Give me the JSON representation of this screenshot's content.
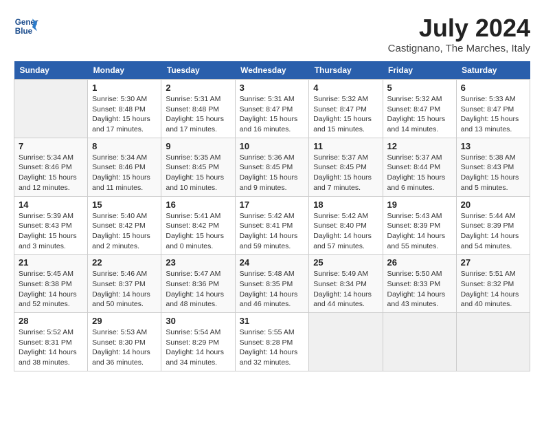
{
  "header": {
    "logo_line1": "General",
    "logo_line2": "Blue",
    "month_title": "July 2024",
    "location": "Castignano, The Marches, Italy"
  },
  "columns": [
    "Sunday",
    "Monday",
    "Tuesday",
    "Wednesday",
    "Thursday",
    "Friday",
    "Saturday"
  ],
  "weeks": [
    [
      {
        "day": "",
        "info": ""
      },
      {
        "day": "1",
        "info": "Sunrise: 5:30 AM\nSunset: 8:48 PM\nDaylight: 15 hours\nand 17 minutes."
      },
      {
        "day": "2",
        "info": "Sunrise: 5:31 AM\nSunset: 8:48 PM\nDaylight: 15 hours\nand 17 minutes."
      },
      {
        "day": "3",
        "info": "Sunrise: 5:31 AM\nSunset: 8:47 PM\nDaylight: 15 hours\nand 16 minutes."
      },
      {
        "day": "4",
        "info": "Sunrise: 5:32 AM\nSunset: 8:47 PM\nDaylight: 15 hours\nand 15 minutes."
      },
      {
        "day": "5",
        "info": "Sunrise: 5:32 AM\nSunset: 8:47 PM\nDaylight: 15 hours\nand 14 minutes."
      },
      {
        "day": "6",
        "info": "Sunrise: 5:33 AM\nSunset: 8:47 PM\nDaylight: 15 hours\nand 13 minutes."
      }
    ],
    [
      {
        "day": "7",
        "info": "Sunrise: 5:34 AM\nSunset: 8:46 PM\nDaylight: 15 hours\nand 12 minutes."
      },
      {
        "day": "8",
        "info": "Sunrise: 5:34 AM\nSunset: 8:46 PM\nDaylight: 15 hours\nand 11 minutes."
      },
      {
        "day": "9",
        "info": "Sunrise: 5:35 AM\nSunset: 8:45 PM\nDaylight: 15 hours\nand 10 minutes."
      },
      {
        "day": "10",
        "info": "Sunrise: 5:36 AM\nSunset: 8:45 PM\nDaylight: 15 hours\nand 9 minutes."
      },
      {
        "day": "11",
        "info": "Sunrise: 5:37 AM\nSunset: 8:45 PM\nDaylight: 15 hours\nand 7 minutes."
      },
      {
        "day": "12",
        "info": "Sunrise: 5:37 AM\nSunset: 8:44 PM\nDaylight: 15 hours\nand 6 minutes."
      },
      {
        "day": "13",
        "info": "Sunrise: 5:38 AM\nSunset: 8:43 PM\nDaylight: 15 hours\nand 5 minutes."
      }
    ],
    [
      {
        "day": "14",
        "info": "Sunrise: 5:39 AM\nSunset: 8:43 PM\nDaylight: 15 hours\nand 3 minutes."
      },
      {
        "day": "15",
        "info": "Sunrise: 5:40 AM\nSunset: 8:42 PM\nDaylight: 15 hours\nand 2 minutes."
      },
      {
        "day": "16",
        "info": "Sunrise: 5:41 AM\nSunset: 8:42 PM\nDaylight: 15 hours\nand 0 minutes."
      },
      {
        "day": "17",
        "info": "Sunrise: 5:42 AM\nSunset: 8:41 PM\nDaylight: 14 hours\nand 59 minutes."
      },
      {
        "day": "18",
        "info": "Sunrise: 5:42 AM\nSunset: 8:40 PM\nDaylight: 14 hours\nand 57 minutes."
      },
      {
        "day": "19",
        "info": "Sunrise: 5:43 AM\nSunset: 8:39 PM\nDaylight: 14 hours\nand 55 minutes."
      },
      {
        "day": "20",
        "info": "Sunrise: 5:44 AM\nSunset: 8:39 PM\nDaylight: 14 hours\nand 54 minutes."
      }
    ],
    [
      {
        "day": "21",
        "info": "Sunrise: 5:45 AM\nSunset: 8:38 PM\nDaylight: 14 hours\nand 52 minutes."
      },
      {
        "day": "22",
        "info": "Sunrise: 5:46 AM\nSunset: 8:37 PM\nDaylight: 14 hours\nand 50 minutes."
      },
      {
        "day": "23",
        "info": "Sunrise: 5:47 AM\nSunset: 8:36 PM\nDaylight: 14 hours\nand 48 minutes."
      },
      {
        "day": "24",
        "info": "Sunrise: 5:48 AM\nSunset: 8:35 PM\nDaylight: 14 hours\nand 46 minutes."
      },
      {
        "day": "25",
        "info": "Sunrise: 5:49 AM\nSunset: 8:34 PM\nDaylight: 14 hours\nand 44 minutes."
      },
      {
        "day": "26",
        "info": "Sunrise: 5:50 AM\nSunset: 8:33 PM\nDaylight: 14 hours\nand 43 minutes."
      },
      {
        "day": "27",
        "info": "Sunrise: 5:51 AM\nSunset: 8:32 PM\nDaylight: 14 hours\nand 40 minutes."
      }
    ],
    [
      {
        "day": "28",
        "info": "Sunrise: 5:52 AM\nSunset: 8:31 PM\nDaylight: 14 hours\nand 38 minutes."
      },
      {
        "day": "29",
        "info": "Sunrise: 5:53 AM\nSunset: 8:30 PM\nDaylight: 14 hours\nand 36 minutes."
      },
      {
        "day": "30",
        "info": "Sunrise: 5:54 AM\nSunset: 8:29 PM\nDaylight: 14 hours\nand 34 minutes."
      },
      {
        "day": "31",
        "info": "Sunrise: 5:55 AM\nSunset: 8:28 PM\nDaylight: 14 hours\nand 32 minutes."
      },
      {
        "day": "",
        "info": ""
      },
      {
        "day": "",
        "info": ""
      },
      {
        "day": "",
        "info": ""
      }
    ]
  ]
}
